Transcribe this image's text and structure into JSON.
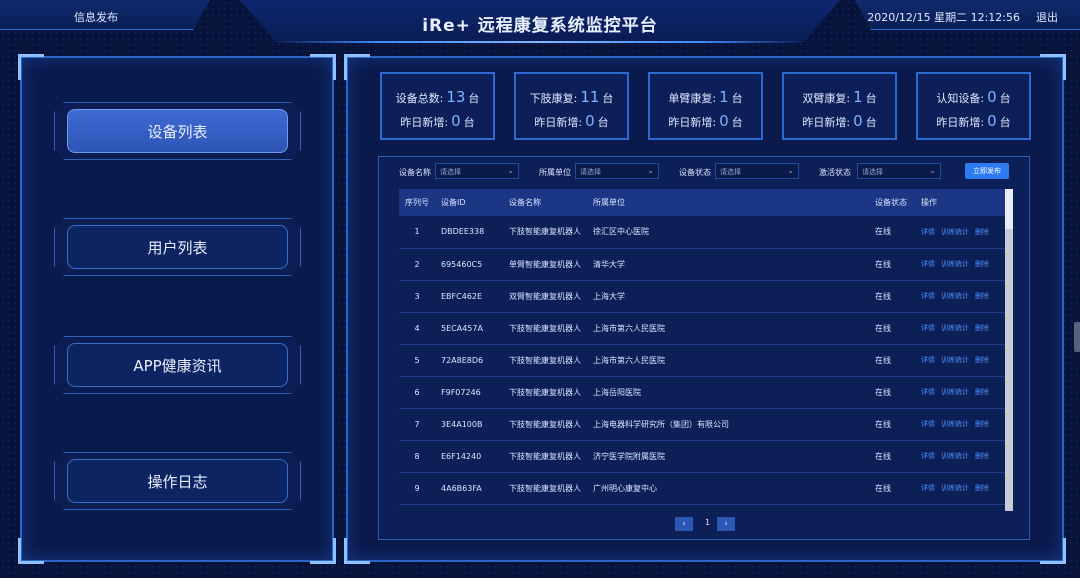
{
  "header": {
    "left_label": "信息发布",
    "title": "iRe+ 远程康复系统监控平台",
    "datetime": "2020/12/15 星期二 12:12:56",
    "logout": "退出"
  },
  "nav": {
    "items": [
      {
        "label": "设备列表",
        "active": true
      },
      {
        "label": "用户列表",
        "active": false
      },
      {
        "label": "APP健康资讯",
        "active": false
      },
      {
        "label": "操作日志",
        "active": false
      }
    ]
  },
  "stats": [
    {
      "label": "设备总数:",
      "value": "13",
      "unit": "台",
      "new_label": "昨日新增:",
      "new_value": "0",
      "new_unit": "台"
    },
    {
      "label": "下肢康复:",
      "value": "11",
      "unit": "台",
      "new_label": "昨日新增:",
      "new_value": "0",
      "new_unit": "台"
    },
    {
      "label": "单臂康复:",
      "value": "1",
      "unit": "台",
      "new_label": "昨日新增:",
      "new_value": "0",
      "new_unit": "台"
    },
    {
      "label": "双臂康复:",
      "value": "1",
      "unit": "台",
      "new_label": "昨日新增:",
      "new_value": "0",
      "new_unit": "台"
    },
    {
      "label": "认知设备:",
      "value": "0",
      "unit": "台",
      "new_label": "昨日新增:",
      "new_value": "0",
      "new_unit": "台"
    }
  ],
  "filters": {
    "device_name_label": "设备名称",
    "unit_label": "所属单位",
    "status_label": "设备状态",
    "activation_label": "激活状态",
    "placeholder": "请选择",
    "publish_button": "立即发布"
  },
  "table": {
    "columns": [
      "序列号",
      "设备ID",
      "设备名称",
      "所属单位",
      "设备状态",
      "操作"
    ],
    "actions": [
      "详情",
      "训练统计",
      "删除"
    ],
    "rows": [
      {
        "idx": "1",
        "id": "DBDEE338",
        "name": "下肢智能康复机器人",
        "unit": "徐汇区中心医院",
        "status": "在线"
      },
      {
        "idx": "2",
        "id": "695460C5",
        "name": "单臂智能康复机器人",
        "unit": "清华大学",
        "status": "在线"
      },
      {
        "idx": "3",
        "id": "EBFC462E",
        "name": "双臂智能康复机器人",
        "unit": "上海大学",
        "status": "在线"
      },
      {
        "idx": "4",
        "id": "5ECA457A",
        "name": "下肢智能康复机器人",
        "unit": "上海市第六人民医院",
        "status": "在线"
      },
      {
        "idx": "5",
        "id": "72A8E8D6",
        "name": "下肢智能康复机器人",
        "unit": "上海市第六人民医院",
        "status": "在线"
      },
      {
        "idx": "6",
        "id": "F9F07246",
        "name": "下肢智能康复机器人",
        "unit": "上海岳阳医院",
        "status": "在线"
      },
      {
        "idx": "7",
        "id": "3E4A100B",
        "name": "下肢智能康复机器人",
        "unit": "上海电器科学研究所（集团）有限公司",
        "status": "在线"
      },
      {
        "idx": "8",
        "id": "E6F14240",
        "name": "下肢智能康复机器人",
        "unit": "济宁医学院附属医院",
        "status": "在线"
      },
      {
        "idx": "9",
        "id": "4A6B63FA",
        "name": "下肢智能康复机器人",
        "unit": "广州明心康复中心",
        "status": "在线"
      }
    ]
  },
  "pager": {
    "prev": "‹",
    "current": "1",
    "next": "›"
  }
}
